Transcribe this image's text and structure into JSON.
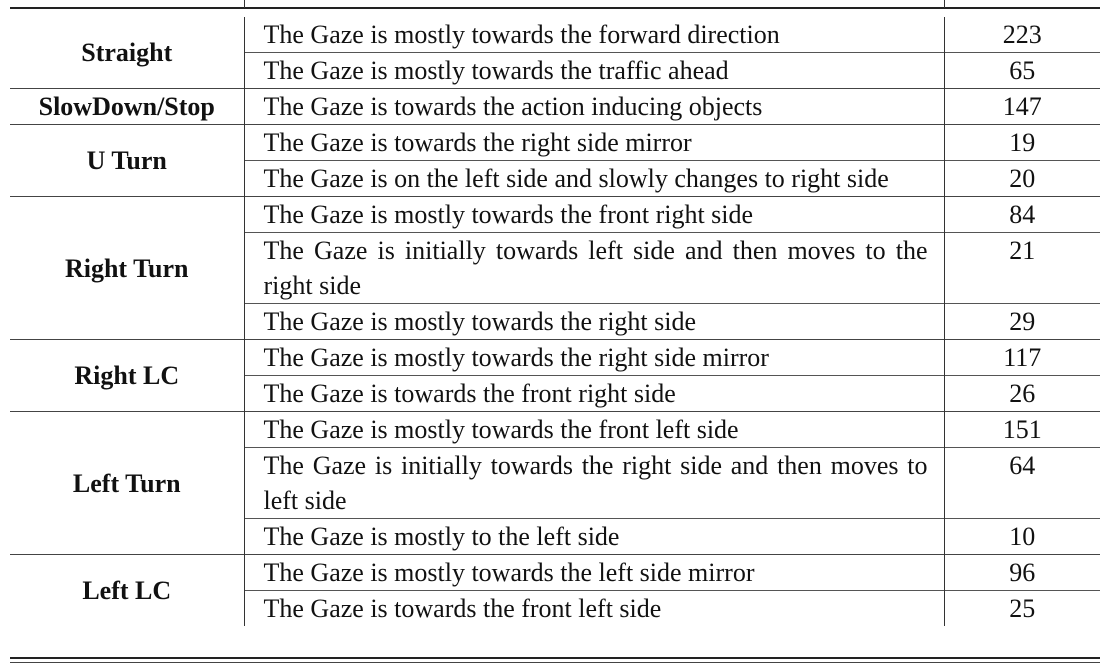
{
  "table": {
    "groups": [
      {
        "category": "Straight",
        "rows": [
          {
            "description": "The Gaze is mostly towards the forward direction",
            "count": "223"
          },
          {
            "description": "The Gaze is mostly towards the traffic ahead",
            "count": "65"
          }
        ]
      },
      {
        "category": "SlowDown/Stop",
        "rows": [
          {
            "description": "The Gaze is towards the action inducing objects",
            "count": "147"
          }
        ]
      },
      {
        "category": "U Turn",
        "rows": [
          {
            "description": "The Gaze is towards the right side mirror",
            "count": "19"
          },
          {
            "description": "The Gaze is on the left side and slowly changes to right side",
            "count": "20"
          }
        ]
      },
      {
        "category": "Right Turn",
        "rows": [
          {
            "description": "The Gaze is mostly towards the front right side",
            "count": "84"
          },
          {
            "description": "The Gaze is initially towards left side and then moves to the right side",
            "count": "21"
          },
          {
            "description": "The Gaze is mostly towards the right side",
            "count": "29"
          }
        ]
      },
      {
        "category": "Right LC",
        "rows": [
          {
            "description": "The Gaze is mostly towards the right side mirror",
            "count": "117"
          },
          {
            "description": "The Gaze is towards the front right side",
            "count": "26"
          }
        ]
      },
      {
        "category": "Left Turn",
        "rows": [
          {
            "description": "The Gaze is mostly towards the front left side",
            "count": "151"
          },
          {
            "description": "The Gaze is initially towards the right side and then moves to left side",
            "count": "64"
          },
          {
            "description": "The Gaze is mostly to the left side",
            "count": "10"
          }
        ]
      },
      {
        "category": "Left LC",
        "rows": [
          {
            "description": "The Gaze is mostly towards the left side mirror",
            "count": "96"
          },
          {
            "description": "The Gaze is towards the front left side",
            "count": "25"
          }
        ]
      }
    ]
  }
}
